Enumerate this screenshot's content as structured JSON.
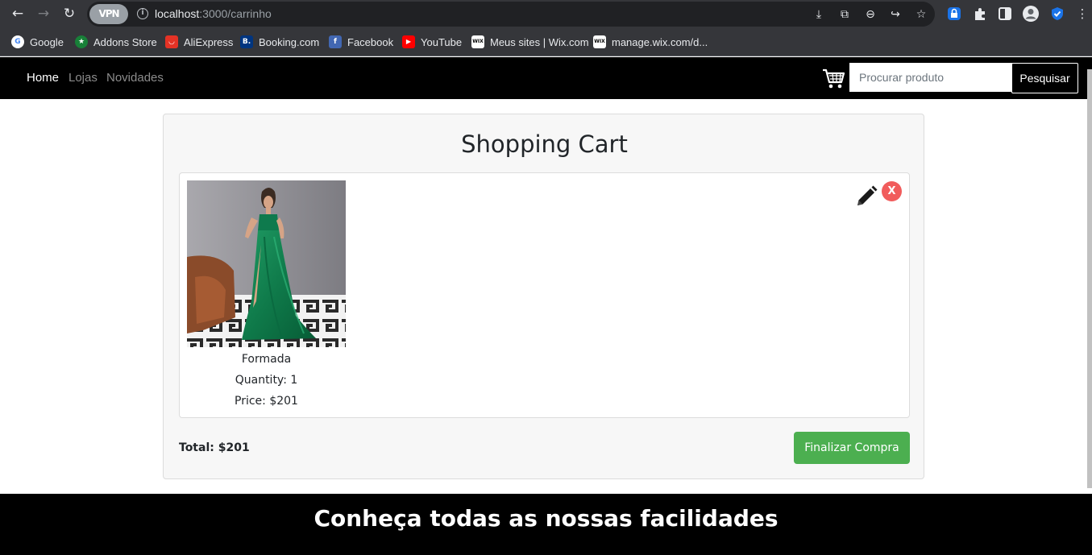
{
  "browser": {
    "url_host": "localhost",
    "url_path": ":3000/carrinho",
    "vpn_label": "VPN",
    "info_glyph": "i",
    "nav": {
      "back_glyph": "←",
      "forward_glyph": "→",
      "reload_glyph": "↻"
    },
    "omnibox_icons": [
      "install-icon",
      "translate-icon",
      "zoom-icon",
      "share-icon",
      "star-icon"
    ],
    "extension_icons": [
      "extension-lock-icon",
      "puzzle-icon",
      "sidepanel-icon",
      "profile-icon",
      "shield-icon",
      "kebab-menu-icon"
    ],
    "bookmarks": [
      {
        "label": "Google",
        "icon": "google-icon",
        "color": "#ffffff",
        "glyph": "G",
        "text_color": "#4285f4"
      },
      {
        "label": "Addons Store",
        "icon": "addons-store-icon",
        "color": "#188038",
        "glyph": "★",
        "text_color": "#ffffff"
      },
      {
        "label": "AliExpress",
        "icon": "aliexpress-icon",
        "color": "#e43225",
        "glyph": "◡",
        "text_color": "#ffffff"
      },
      {
        "label": "Booking.com",
        "icon": "booking-icon",
        "color": "#003580",
        "glyph": "B.",
        "text_color": "#ffffff"
      },
      {
        "label": "Facebook",
        "icon": "facebook-icon",
        "color": "#4267b2",
        "glyph": "f",
        "text_color": "#ffffff"
      },
      {
        "label": "YouTube",
        "icon": "youtube-icon",
        "color": "#ff0000",
        "glyph": "▶",
        "text_color": "#ffffff"
      },
      {
        "label": "Meus sites | Wix.com",
        "icon": "wix-icon",
        "color": "#ffffff",
        "glyph": "WIX",
        "text_color": "#000000"
      },
      {
        "label": "manage.wix.com/d...",
        "icon": "wix-icon",
        "color": "#ffffff",
        "glyph": "WIX",
        "text_color": "#000000"
      }
    ]
  },
  "site_nav": {
    "links": [
      "Home",
      "Lojas",
      "Novidades"
    ],
    "search_placeholder": "Procurar produto",
    "search_button": "Pesquisar"
  },
  "cart": {
    "title": "Shopping Cart",
    "items": [
      {
        "name": "Formada",
        "quantity": "Quantity: 1",
        "price": "Price: $201",
        "image": "green-dress-photo"
      }
    ],
    "remove_label": "X",
    "total": "Total: $201",
    "checkout_button": "Finalizar Compra"
  },
  "footer": {
    "title": "Conheça todas as nossas facilidades"
  },
  "colors": {
    "nav_bg": "#000000",
    "checkout_green": "#4caf50",
    "remove_red": "#f15c5c",
    "panel_bg": "#f7f7f7"
  }
}
